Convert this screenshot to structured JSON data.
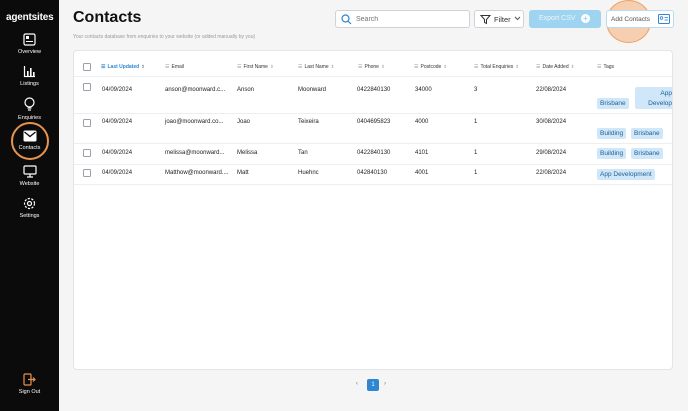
{
  "app": {
    "logo": "agentsites"
  },
  "sidebar": {
    "items": [
      {
        "label": "Overview",
        "icon": "overview-icon"
      },
      {
        "label": "Listings",
        "icon": "chart-icon"
      },
      {
        "label": "Enquiries",
        "icon": "lightbulb-icon"
      },
      {
        "label": "Contacts",
        "icon": "mail-icon",
        "active": true
      },
      {
        "label": "Website",
        "icon": "monitor-icon"
      },
      {
        "label": "Settings",
        "icon": "gear-icon"
      }
    ],
    "sign_out": "Sign Out"
  },
  "header": {
    "title": "Contacts",
    "subtitle": "Your contacts database from enquiries to your website (or added manually by you)",
    "search_placeholder": "Search",
    "filter_label": "Filter",
    "export_label": "Export CSV",
    "add_label": "Add Contacts"
  },
  "table": {
    "columns": [
      "Last Updated",
      "Email",
      "First Name",
      "Last Name",
      "Phone",
      "Postcode",
      "Total Enquiries",
      "Date Added",
      "Tags"
    ],
    "rows": [
      {
        "last_updated": "04/09/2024",
        "email": "anson@moonward.c...",
        "first_name": "Anson",
        "last_name": "Moonward",
        "phone": "0422840130",
        "postcode": "34000",
        "total_enquiries": "3",
        "date_added": "22/08/2024",
        "tags": [
          "Brisbane",
          "App Develop"
        ]
      },
      {
        "last_updated": "04/09/2024",
        "email": "joao@moonward.co...",
        "first_name": "Joao",
        "last_name": "Teixeira",
        "phone": "0404695823",
        "postcode": "4000",
        "total_enquiries": "1",
        "date_added": "30/08/2024",
        "tags": [
          "Building",
          "Brisbane"
        ]
      },
      {
        "last_updated": "04/09/2024",
        "email": "melissa@moonward...",
        "first_name": "Melissa",
        "last_name": "Tan",
        "phone": "0422840130",
        "postcode": "4101",
        "total_enquiries": "1",
        "date_added": "29/08/2024",
        "tags": [
          "Building",
          "Brisbane"
        ]
      },
      {
        "last_updated": "04/09/2024",
        "email": "Matthow@moonward....",
        "first_name": "Matt",
        "last_name": "Huehnc",
        "phone": "042840130",
        "postcode": "4001",
        "total_enquiries": "1",
        "date_added": "22/08/2024",
        "tags": [
          "App Development"
        ]
      }
    ]
  },
  "pagination": {
    "current_page": "1",
    "prev": "‹",
    "next": "›"
  },
  "colors": {
    "accent": "#2f86d1",
    "highlight_ring": "#e8934e",
    "tag_bg": "#cfe7f8",
    "sidebar_bg": "#0b0b0c"
  }
}
